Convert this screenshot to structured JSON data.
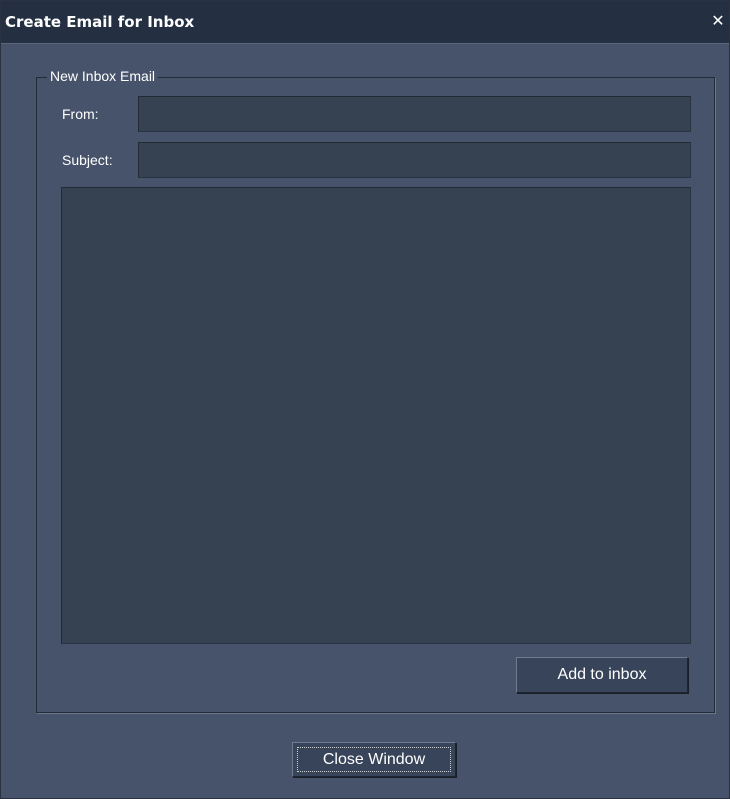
{
  "window": {
    "title": "Create Email for Inbox",
    "close_glyph": "✕",
    "close_icon": "close-icon"
  },
  "group": {
    "legend": "New Inbox Email",
    "from_label": "From:",
    "from_value": "",
    "subject_label": "Subject:",
    "subject_value": "",
    "body_value": "",
    "add_button_label": "Add to inbox"
  },
  "footer": {
    "close_button_label": "Close Window"
  },
  "colors": {
    "window_bg": "#47536a",
    "titlebar_bg": "#243042",
    "field_bg": "#364252",
    "button_bg": "#38445a",
    "text": "#ffffff"
  }
}
